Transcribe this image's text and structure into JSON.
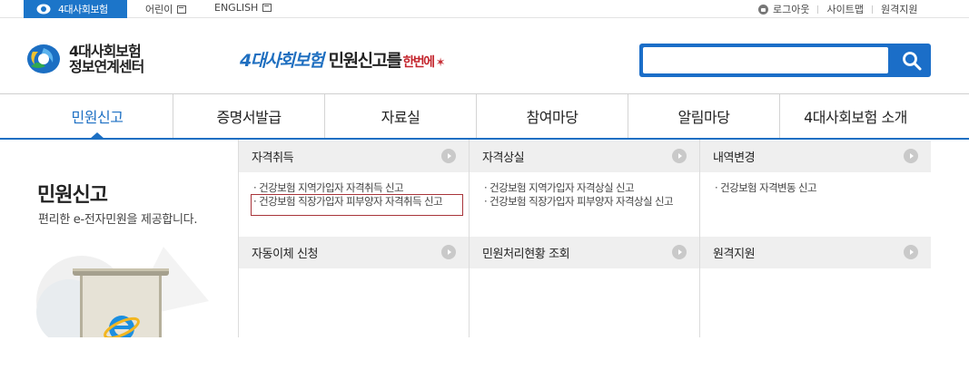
{
  "topbar": {
    "home_tab": "4대사회보험",
    "kids": "어린이",
    "english": "ENGLISH",
    "logout": "로그아웃",
    "sitemap": "사이트맵",
    "remote_support": "원격지원"
  },
  "header": {
    "brand_line1": "4대사회보험",
    "brand_line2": "정보연계센터",
    "slogan_a": "4대사회보험",
    "slogan_b": "민원신고를",
    "slogan_c": "한번에",
    "search_placeholder": "",
    "colors": {
      "brand_blue": "#1c6fc3",
      "accent_red": "#c4262e",
      "green": "#2fa84f"
    }
  },
  "nav": [
    {
      "label": "민원신고",
      "active": true
    },
    {
      "label": "증명서발급",
      "active": false
    },
    {
      "label": "자료실",
      "active": false
    },
    {
      "label": "참여마당",
      "active": false
    },
    {
      "label": "알림마당",
      "active": false
    },
    {
      "label": "4대사회보험 소개",
      "active": false
    }
  ],
  "left_panel": {
    "title": "민원신고",
    "subtitle": "편리한 e-전자민원을 제공합니다."
  },
  "submenu": {
    "row1": [
      {
        "title": "자격취득",
        "links": [
          "· 건강보험 지역가입자 자격취득 신고",
          "· 건강보험 직장가입자 피부양자 자격취득 신고"
        ]
      },
      {
        "title": "자격상실",
        "links": [
          "· 건강보험 지역가입자 자격상실 신고",
          "· 건강보험 직장가입자 피부양자 자격상실 신고"
        ]
      },
      {
        "title": "내역변경",
        "links": [
          "· 건강보험 자격변동 신고"
        ]
      }
    ],
    "row2": [
      {
        "title": "자동이체 신청"
      },
      {
        "title": "민원처리현황 조회"
      },
      {
        "title": "원격지원"
      }
    ]
  }
}
